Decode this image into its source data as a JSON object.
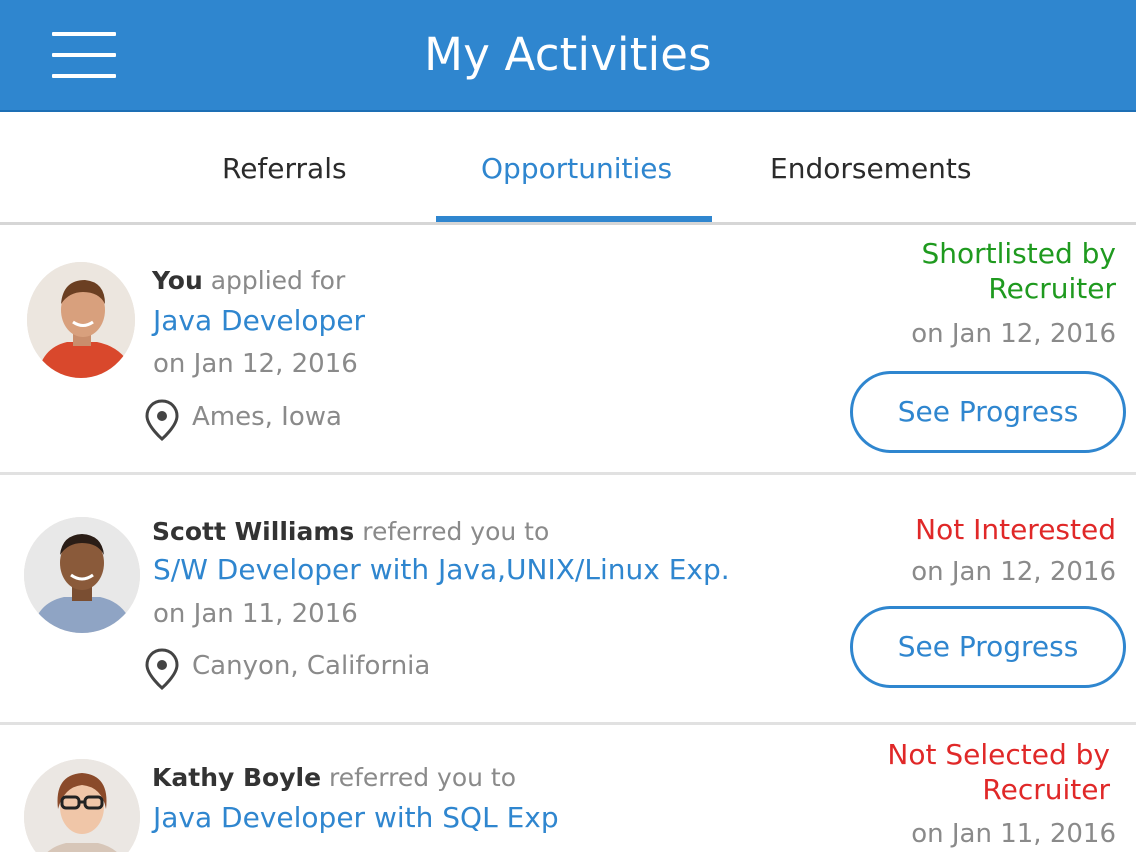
{
  "header": {
    "title": "My Activities",
    "menu_icon": "hamburger-menu-icon"
  },
  "tabs": [
    {
      "label": "Referrals",
      "active": false
    },
    {
      "label": "Opportunities",
      "active": true
    },
    {
      "label": "Endorsements",
      "active": false
    }
  ],
  "colors": {
    "primary": "#2f86cf",
    "status_positive": "#1f9a1f",
    "status_negative": "#e02828",
    "muted_text": "#8a8a8a"
  },
  "activities": [
    {
      "actor": "You",
      "action": " applied for",
      "job_title": "Java Developer",
      "date": "on Jan 12, 2016",
      "location": "Ames, Iowa",
      "status_line1": "Shortlisted by",
      "status_line2": "Recruiter",
      "status_color": "green",
      "status_date": "on Jan 12, 2016",
      "button_label": "See Progress"
    },
    {
      "actor": "Scott Williams",
      "action": " referred you to",
      "job_title": "S/W Developer with Java,UNIX/Linux Exp.",
      "date": "on Jan 11, 2016",
      "location": "Canyon, California",
      "status_line1": "Not Interested",
      "status_color": "red",
      "status_date": "on Jan 12, 2016",
      "button_label": "See Progress"
    },
    {
      "actor": "Kathy Boyle",
      "action": " referred you to",
      "job_title": "Java Developer with SQL Exp",
      "status_line1": "Not Selected by",
      "status_line2": "Recruiter",
      "status_color": "red",
      "status_date": "on Jan 11, 2016"
    }
  ]
}
